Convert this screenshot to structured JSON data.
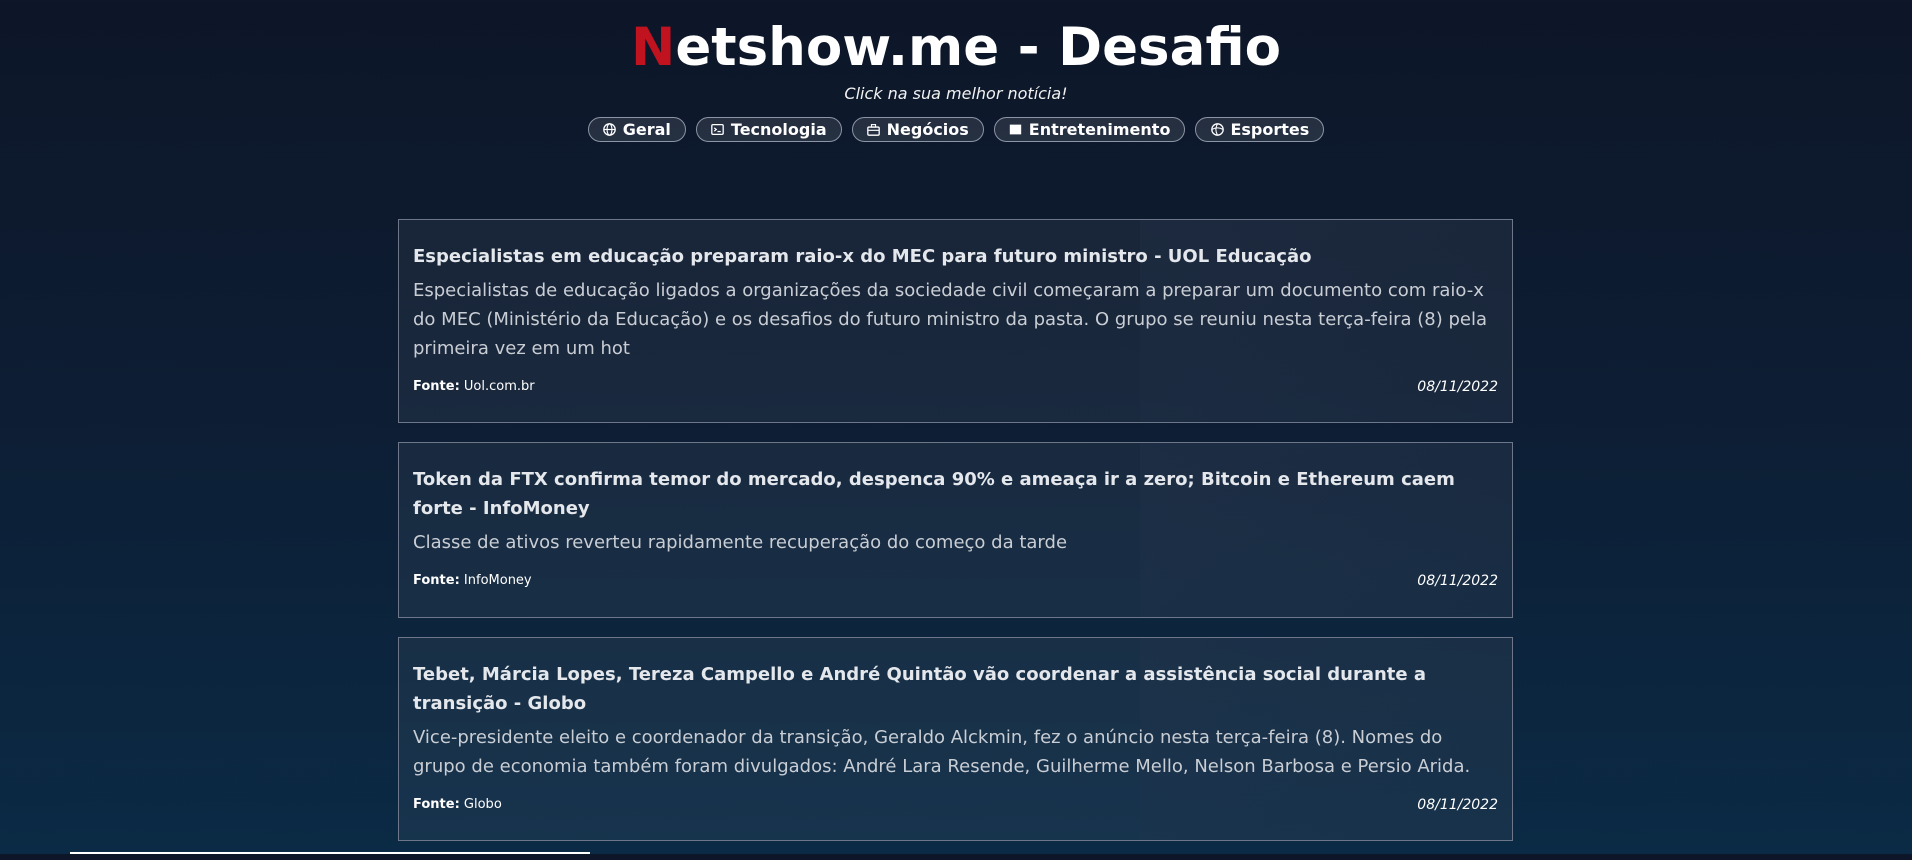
{
  "header": {
    "title_first_letter": "N",
    "title_rest": "etshow.me - Desafio",
    "subtitle": "Click na sua melhor notícia!"
  },
  "nav": {
    "items": [
      {
        "label": "Geral",
        "icon": "globe-icon"
      },
      {
        "label": "Tecnologia",
        "icon": "terminal-icon"
      },
      {
        "label": "Negócios",
        "icon": "briefcase-icon"
      },
      {
        "label": "Entretenimento",
        "icon": "film-icon"
      },
      {
        "label": "Esportes",
        "icon": "ball-icon"
      }
    ]
  },
  "news": [
    {
      "title": "Especialistas em educação preparam raio-x do MEC para futuro ministro - UOL Educação",
      "description": "Especialistas de educação ligados a organizações da sociedade civil começaram a preparar um documento com raio-x do MEC (Ministério da Educação) e os desafios do futuro ministro da pasta. O grupo se reuniu nesta terça-feira (8) pela primeira vez em um hot",
      "source_label": "Fonte:",
      "source": "Uol.com.br",
      "date": "08/11/2022"
    },
    {
      "title": "Token da FTX confirma temor do mercado, despenca 90% e ameaça ir a zero; Bitcoin e Ethereum caem forte - InfoMoney",
      "description": "Classe de ativos reverteu rapidamente recuperação do começo da tarde",
      "source_label": "Fonte:",
      "source": "InfoMoney",
      "date": "08/11/2022"
    },
    {
      "title": "Tebet, Márcia Lopes, Tereza Campello e André Quintão vão coordenar a assistência social durante a transição - Globo",
      "description": "Vice-presidente eleito e coordenador da transição, Geraldo Alckmin, fez o anúncio nesta terça-feira (8). Nomes do grupo de economia também foram divulgados: André Lara Resende, Guilherme Mello, Nelson Barbosa e Persio Arida.",
      "source_label": "Fonte:",
      "source": "Globo",
      "date": "08/11/2022"
    }
  ],
  "colors": {
    "accent": "#c1121f",
    "background_top": "#0d1628",
    "background_bottom": "#0b2a45"
  }
}
